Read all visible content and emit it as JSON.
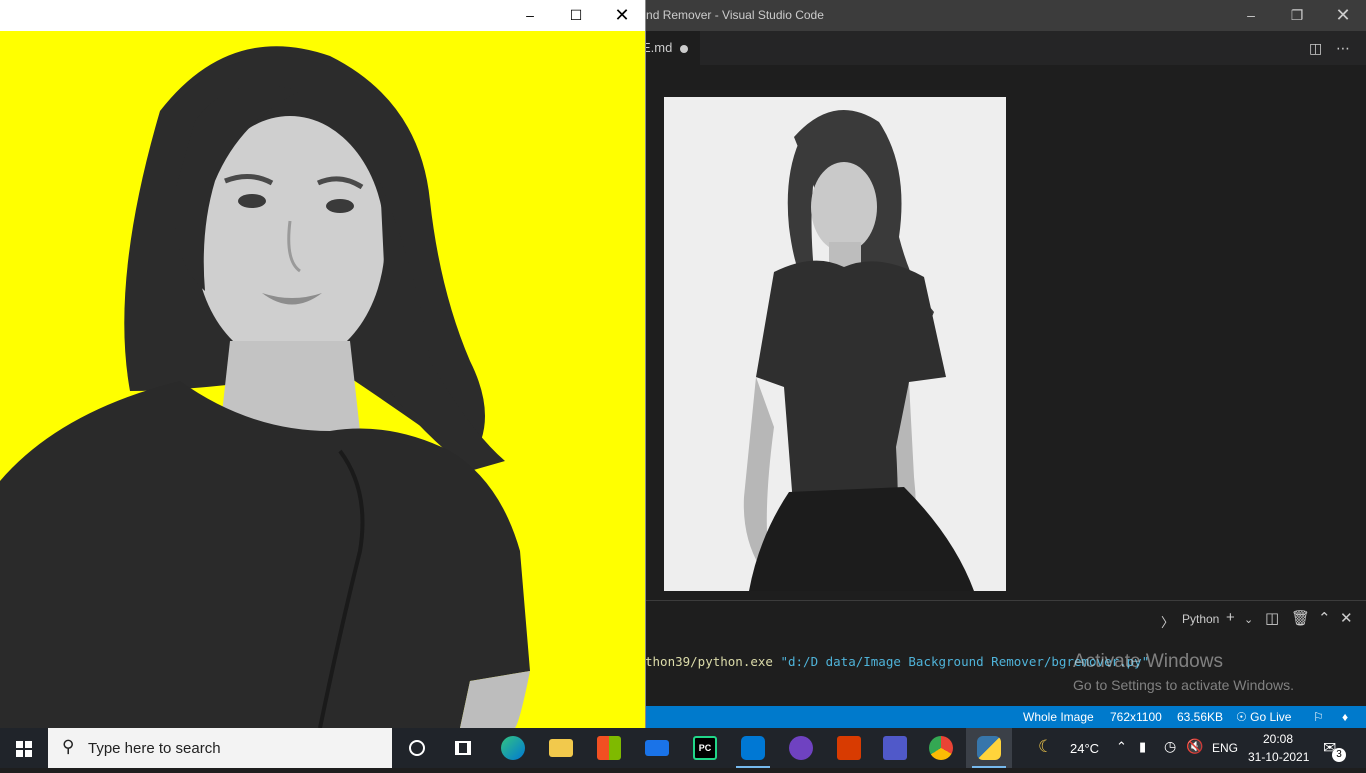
{
  "vscode": {
    "window_title": "Image Background Remover - Visual Studio Code",
    "title_visible": "ground Remover - Visual Studio Code",
    "tab_label": "E.md",
    "terminal": {
      "shell_label": "Python",
      "command_visible": "thon39/python.exe",
      "argument": "\"d:/D data/Image Background Remover/bgremover.py\""
    },
    "status_bar": {
      "mode": "Whole Image",
      "dimensions": "762x1100",
      "size": "63.56KB",
      "go_live": "Go Live"
    },
    "activation": {
      "title": "Activate Windows",
      "subtitle": "Go to Settings to activate Windows."
    }
  },
  "image_window": {
    "background_color": "#ffff00"
  },
  "taskbar": {
    "search_placeholder": "Type here to search",
    "weather": "24°C",
    "language": "ENG",
    "time": "20:08",
    "date": "31-10-2021",
    "notification_count": "3",
    "pinned_icons": [
      "cortana-icon",
      "task-view-icon",
      "edge-icon",
      "file-explorer-icon",
      "store-icon",
      "mail-icon",
      "pycharm-icon",
      "vscode-icon",
      "github-desktop-icon",
      "office-icon",
      "teams-icon",
      "chrome-icon",
      "python-icon"
    ]
  }
}
